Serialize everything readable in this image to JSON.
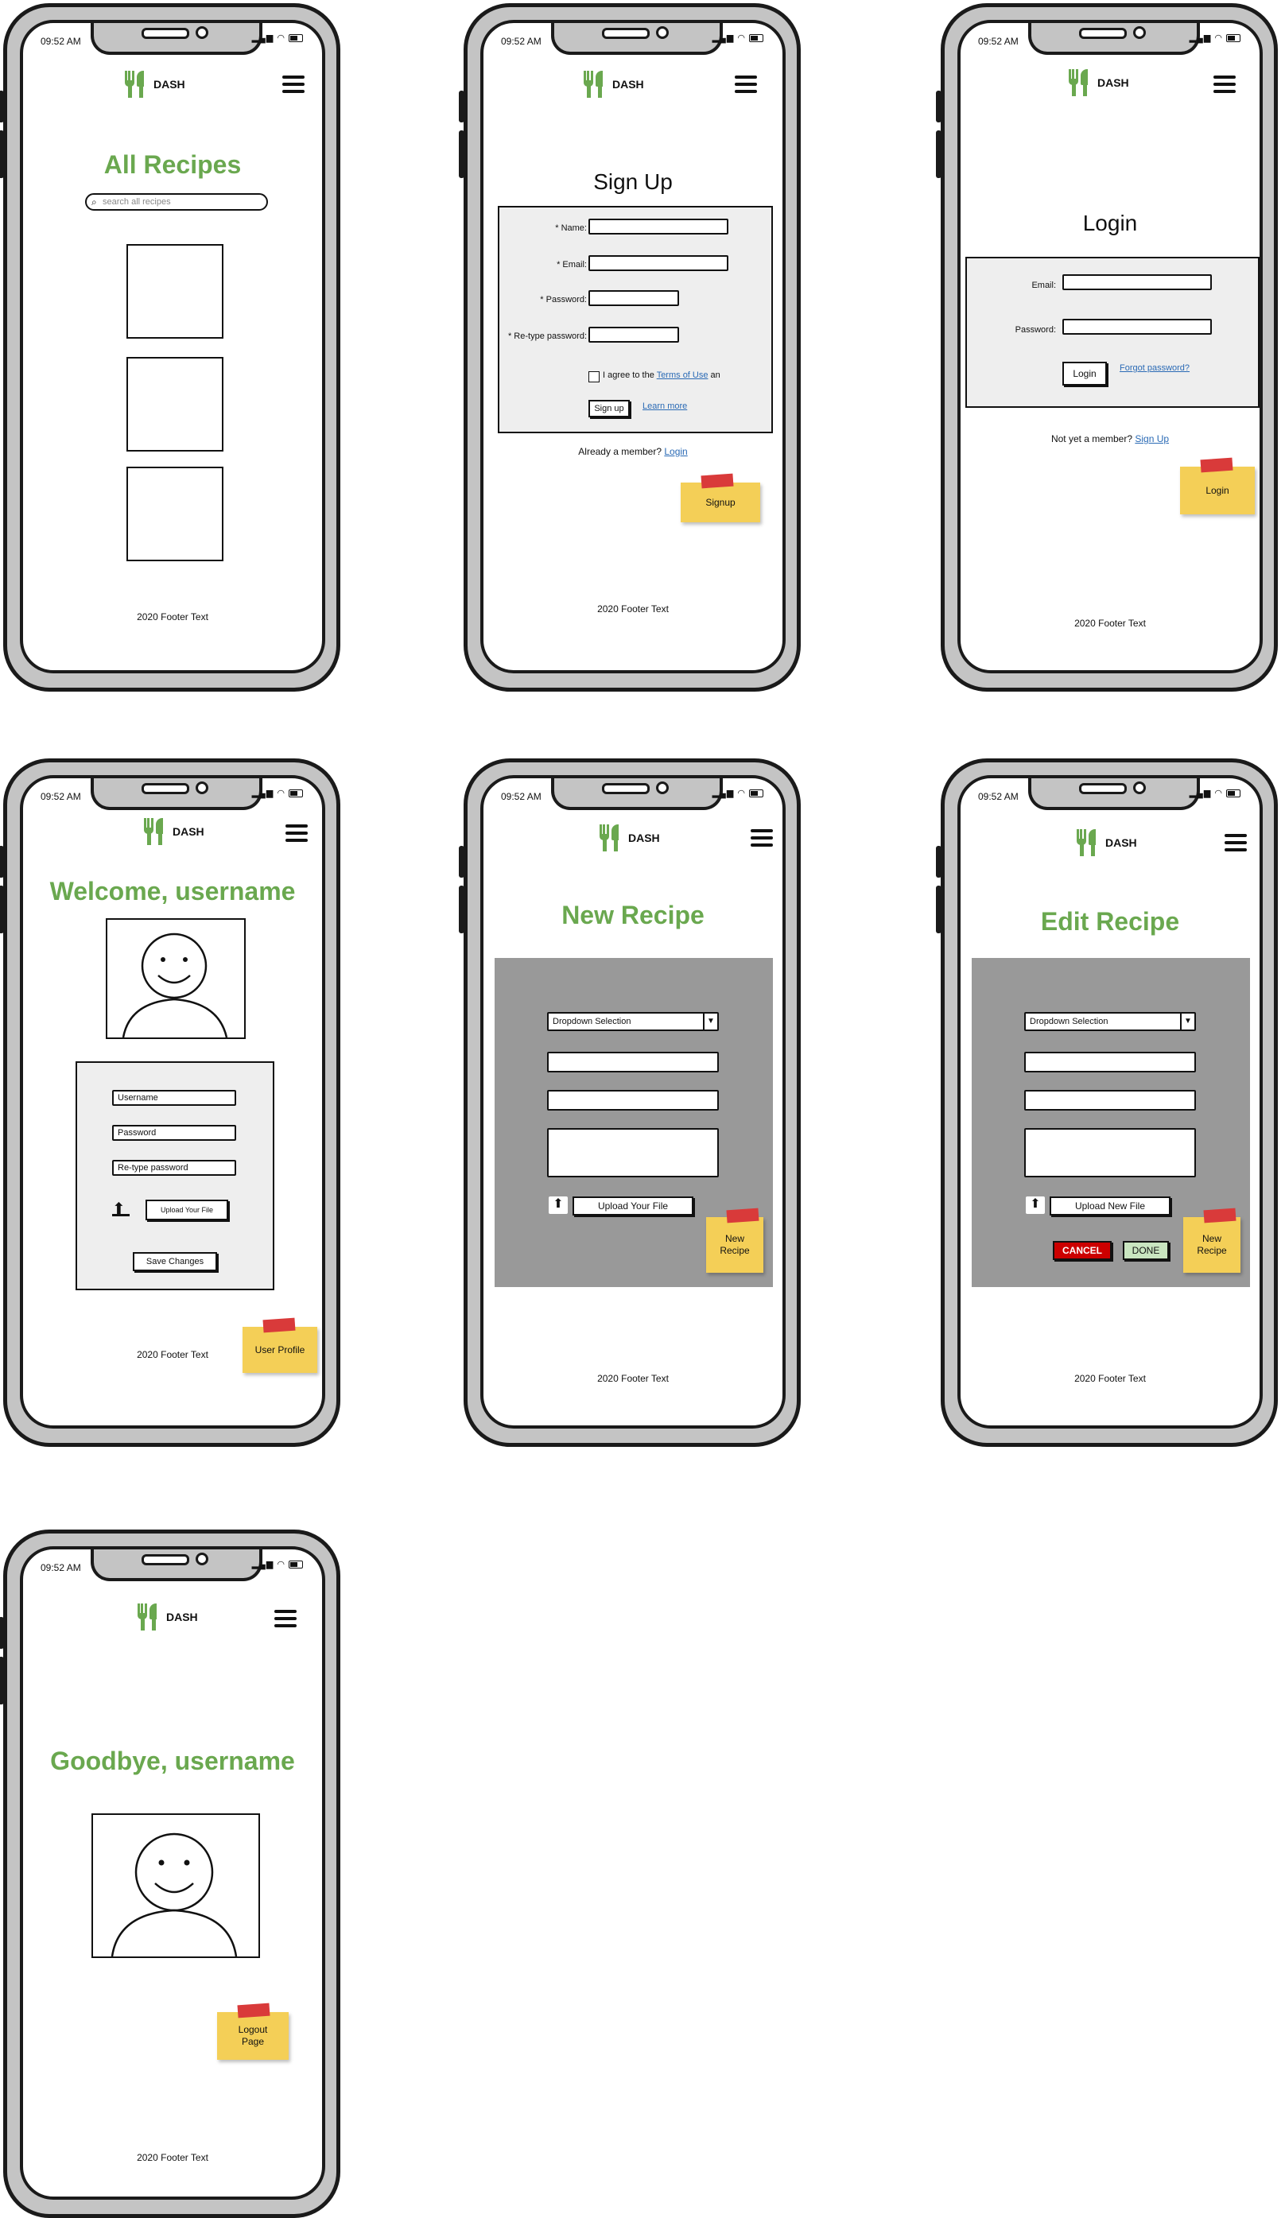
{
  "common": {
    "time": "09:52 AM",
    "brand": "DASH",
    "footer": "2020 Footer Text"
  },
  "all_recipes": {
    "title": "All Recipes",
    "search_placeholder": "search all recipes"
  },
  "signup": {
    "title": "Sign Up",
    "name_label": "* Name:",
    "email_label": "* Email:",
    "password_label": "* Password:",
    "retype_label": "* Re-type password:",
    "agree_text": "I agree to the",
    "terms_link": "Terms of Use",
    "agree_tail": "an",
    "signup_button": "Sign up",
    "learn_more": "Learn more",
    "already_member": "Already a member?",
    "login_link": "Login",
    "sticky": "Signup"
  },
  "login": {
    "title": "Login",
    "email_label": "Email:",
    "password_label": "Password:",
    "login_button": "Login",
    "forgot": "Forgot password?",
    "not_member": "Not yet a member?",
    "signup_link": "Sign Up",
    "sticky": "Login"
  },
  "profile": {
    "title": "Welcome, username",
    "username_value": "Username",
    "password_value": "Password",
    "retype_value": "Re-type password",
    "upload_button": "Upload Your File",
    "save_button": "Save Changes",
    "sticky": "User Profile"
  },
  "new_recipe": {
    "title": "New Recipe",
    "dropdown": "Dropdown Selection",
    "upload_button": "Upload Your File",
    "sticky_line1": "New",
    "sticky_line2": "Recipe"
  },
  "edit_recipe": {
    "title": "Edit Recipe",
    "dropdown": "Dropdown Selection",
    "upload_button": "Upload New File",
    "cancel_button": "CANCEL",
    "done_button": "DONE",
    "sticky_line1": "New",
    "sticky_line2": "Recipe"
  },
  "logout": {
    "title": "Goodbye, username",
    "sticky_line1": "Logout",
    "sticky_line2": "Page"
  },
  "colors": {
    "accent_green": "#6aa84f",
    "sticky_yellow": "#f4cf57",
    "cancel_red": "#cc0000",
    "done_green": "#c9e5c0",
    "panel_grey": "#999999"
  }
}
